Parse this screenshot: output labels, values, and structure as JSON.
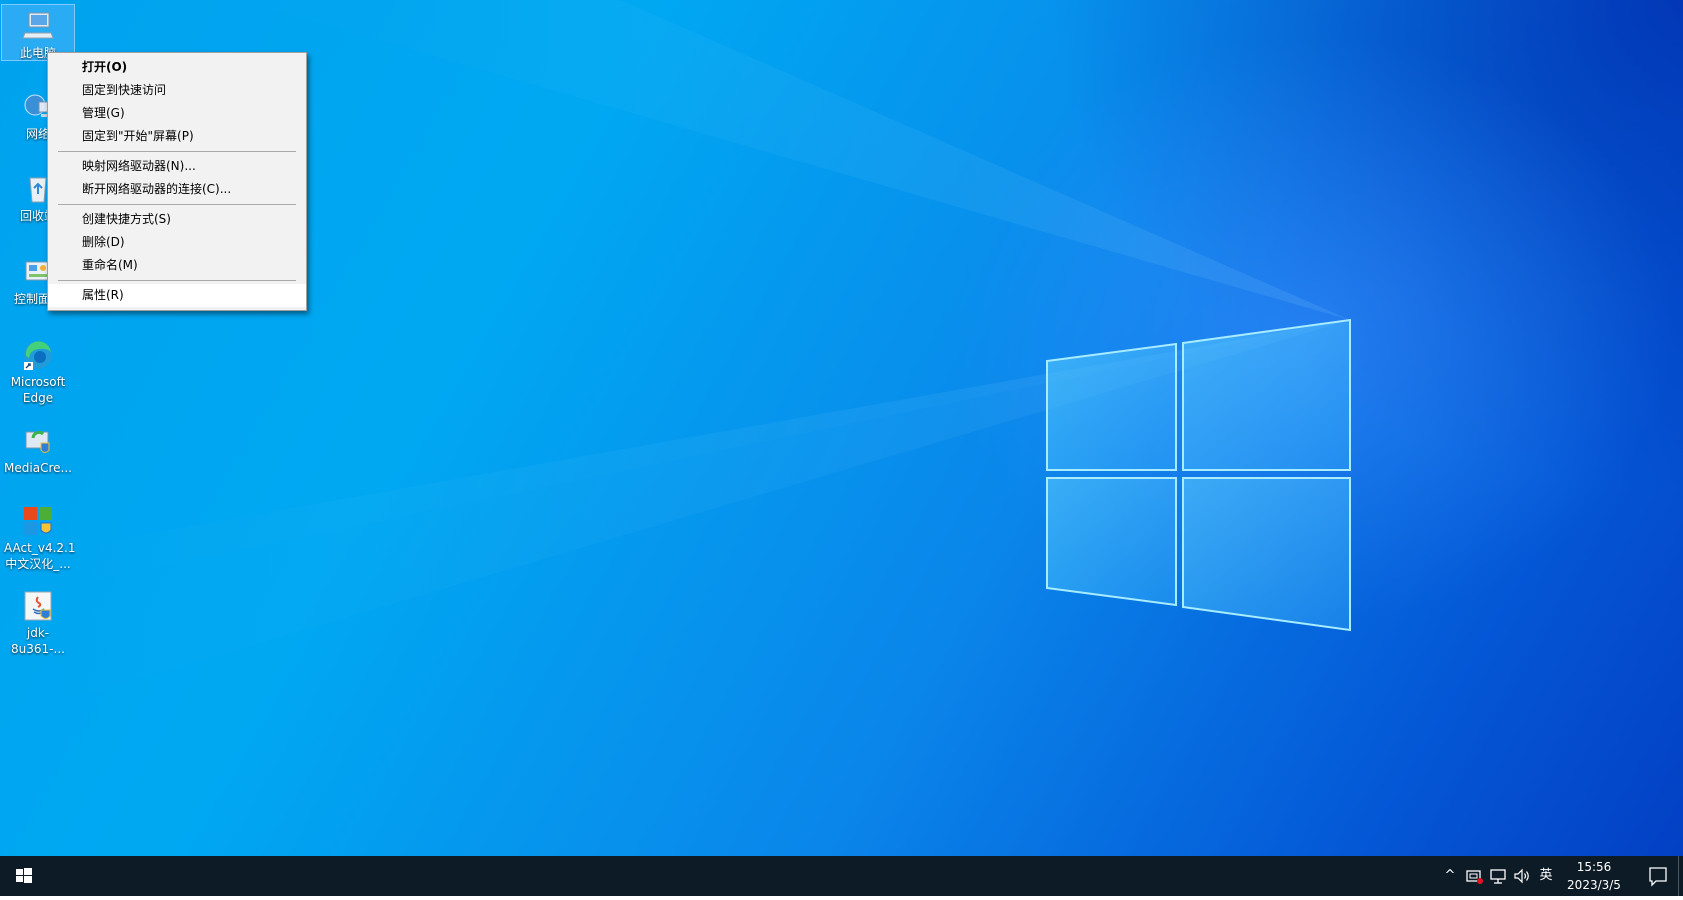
{
  "desktop": {
    "icons": [
      {
        "label": "此电脑",
        "icon": "computer-icon"
      },
      {
        "label": "网络",
        "icon": "network-icon"
      },
      {
        "label": "回收站",
        "icon": "recycle-bin-icon"
      },
      {
        "label": "控制面板",
        "icon": "control-panel-icon"
      },
      {
        "label": "Microsoft Edge",
        "icon": "edge-icon"
      },
      {
        "label": "MediaCre...",
        "icon": "media-creation-tool-icon"
      },
      {
        "label": "AAct_v4.2.1 中文汉化_...",
        "icon": "aact-icon"
      },
      {
        "label": "jdk-8u361-...",
        "icon": "java-installer-icon"
      }
    ]
  },
  "context_menu": {
    "items": [
      {
        "label": "打开(O)"
      },
      {
        "label": "固定到快速访问"
      },
      {
        "label": "管理(G)"
      },
      {
        "label": "固定到\"开始\"屏幕(P)"
      },
      {
        "label": "映射网络驱动器(N)..."
      },
      {
        "label": "断开网络驱动器的连接(C)..."
      },
      {
        "label": "创建快捷方式(S)"
      },
      {
        "label": "删除(D)"
      },
      {
        "label": "重命名(M)"
      },
      {
        "label": "属性(R)"
      }
    ]
  },
  "taskbar": {
    "start_icon": "windows-logo-icon",
    "tray": {
      "chevron": "^",
      "input_method": "英"
    },
    "clock": {
      "time": "15:56",
      "date": "2023/3/5"
    }
  },
  "colors": {
    "taskbar": "#0d1b26",
    "wallpaper_light": "#00a8f2",
    "wallpaper_dark": "#0340c4",
    "menu_bg": "#f2f2f2"
  }
}
